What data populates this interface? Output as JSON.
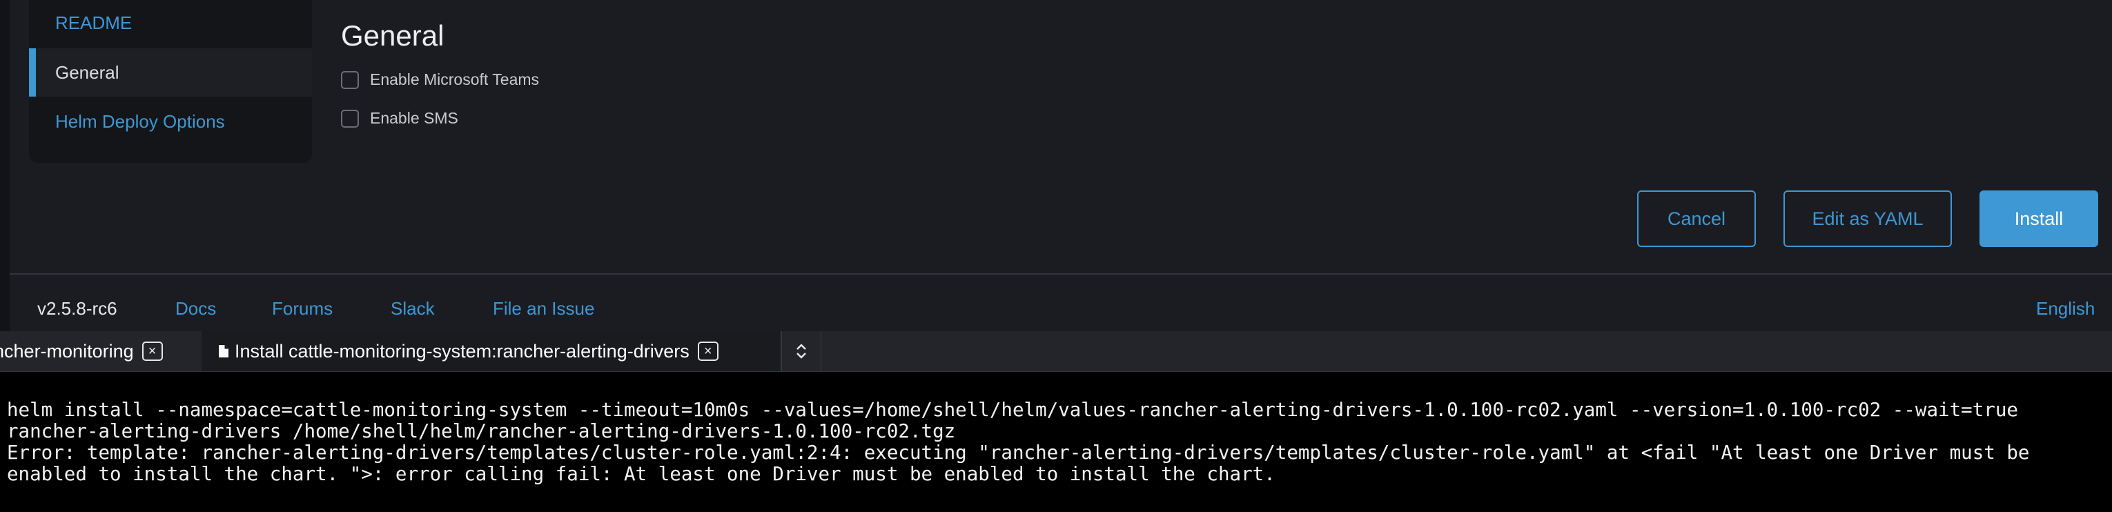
{
  "sidebar": {
    "items": [
      {
        "label": "README"
      },
      {
        "label": "General"
      },
      {
        "label": "Helm Deploy Options"
      }
    ]
  },
  "main": {
    "title": "General",
    "options": [
      {
        "label": "Enable Microsoft Teams",
        "checked": false
      },
      {
        "label": "Enable SMS",
        "checked": false
      }
    ]
  },
  "actions": {
    "cancel": "Cancel",
    "edit_yaml": "Edit as YAML",
    "install": "Install"
  },
  "footer": {
    "version": "v2.5.8-rc6",
    "links": [
      "Docs",
      "Forums",
      "Slack",
      "File an Issue"
    ],
    "language": "English"
  },
  "dock": {
    "tabs": [
      {
        "label": "ancher-monitoring",
        "close": "×"
      },
      {
        "label": "Install cattle-monitoring-system:rancher-alerting-drivers",
        "close": "×",
        "icon": "file-icon"
      }
    ],
    "expander_icon": "chevron-up-down-icon"
  },
  "terminal": {
    "lines": [
      "helm install --namespace=cattle-monitoring-system --timeout=10m0s --values=/home/shell/helm/values-rancher-alerting-drivers-1.0.100-rc02.yaml --version=1.0.100-rc02 --wait=true",
      "rancher-alerting-drivers /home/shell/helm/rancher-alerting-drivers-1.0.100-rc02.tgz",
      "Error: template: rancher-alerting-drivers/templates/cluster-role.yaml:2:4: executing \"rancher-alerting-drivers/templates/cluster-role.yaml\" at <fail \"At least one Driver must be",
      "enabled to install the chart. \">: error calling fail: At least one Driver must be enabled to install the chart."
    ]
  },
  "colors": {
    "accent": "#3d98d3",
    "background": "#1b1c21",
    "terminal_bg": "#000000"
  }
}
